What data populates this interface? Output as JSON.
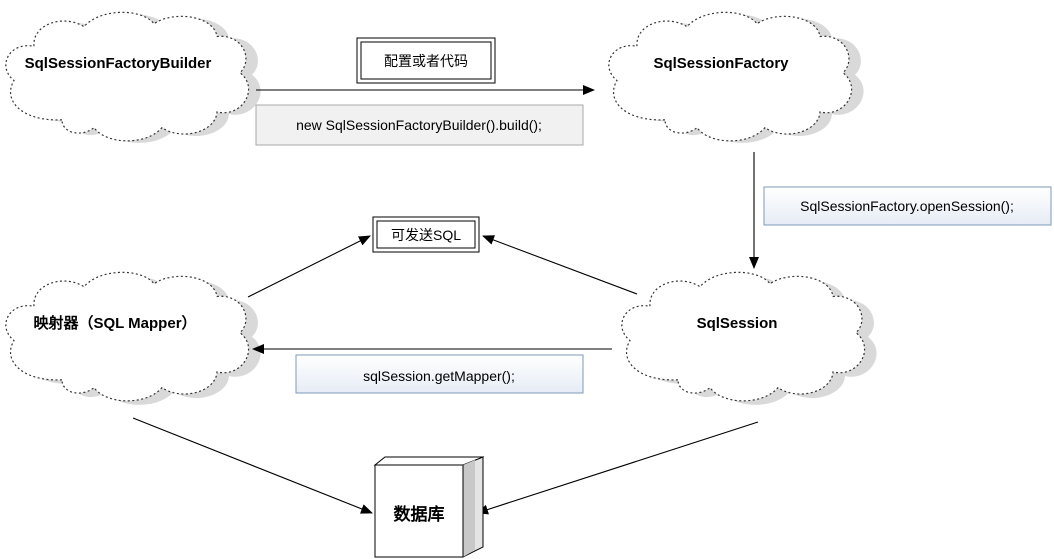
{
  "nodes": {
    "builder": "SqlSessionFactoryBuilder",
    "factory": "SqlSessionFactory",
    "session": "SqlSession",
    "mapper": "映射器（SQL Mapper）",
    "database": "数据库"
  },
  "labels": {
    "config": "配置或者代码",
    "build_call": "new SqlSessionFactoryBuilder().build();",
    "open_session": "SqlSessionFactory.openSession();",
    "send_sql": "可发送SQL",
    "get_mapper": "sqlSession.getMapper();"
  },
  "colors": {
    "cloud_shadow": "#d9d9d9",
    "code_box_builder": "#f1f1f1",
    "code_box_gradient_top": "#ffffff",
    "code_box_gradient_bottom": "#e9eef6",
    "code_box_border_blue": "#7f99b8"
  }
}
